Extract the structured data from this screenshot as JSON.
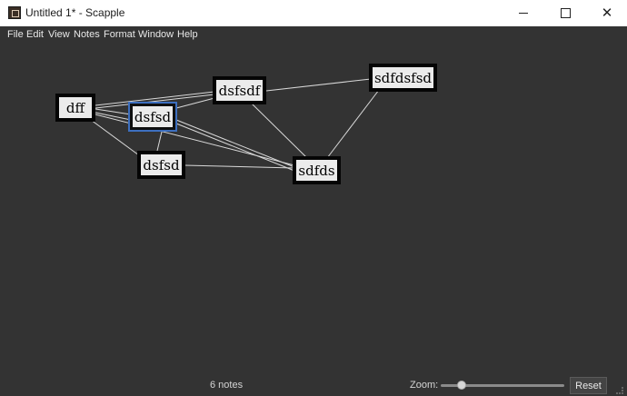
{
  "window": {
    "title": "Untitled 1* - Scapple",
    "minimize_icon": "minimize-icon",
    "maximize_icon": "maximize-icon",
    "close_glyph": "✕"
  },
  "menu": [
    "File",
    "Edit",
    "View",
    "Notes",
    "Format",
    "Window",
    "Help"
  ],
  "notes": [
    {
      "id": "dff",
      "text": "dff",
      "selected": false
    },
    {
      "id": "dsfsd_selected",
      "text": "dsfsd",
      "selected": true
    },
    {
      "id": "dsfsdf",
      "text": "dsfsdf",
      "selected": false
    },
    {
      "id": "sdfdsfsd",
      "text": "sdfdsfsd",
      "selected": false
    },
    {
      "id": "dsfsd_lower",
      "text": "dsfsd",
      "selected": false
    },
    {
      "id": "sdfds",
      "text": "sdfds",
      "selected": false
    }
  ],
  "status": {
    "note_count": "6 notes",
    "zoom_label": "Zoom:",
    "zoom_level": 0.14,
    "reset_label": "Reset"
  },
  "colors": {
    "canvas_bg": "#333333",
    "note_bg": "#ebebeb",
    "note_border": "#050505",
    "selection": "#3d6fbf",
    "connector": "#d9d9d9"
  }
}
